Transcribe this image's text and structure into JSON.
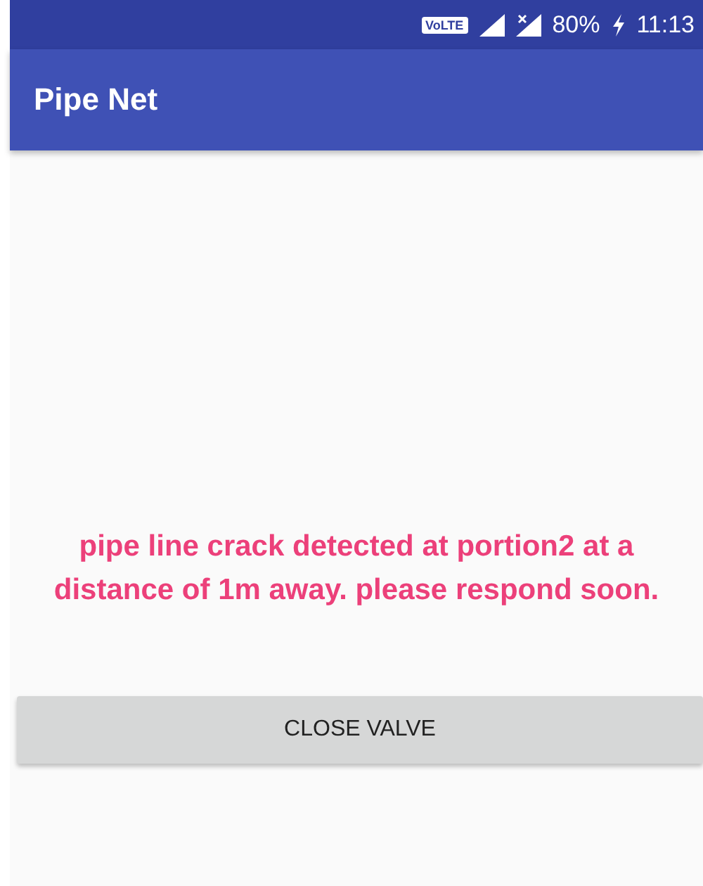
{
  "status_bar": {
    "network_badge": "VoLTE",
    "battery": "80%",
    "time": "11:13"
  },
  "app_bar": {
    "title": "Pipe Net"
  },
  "message": "pipe line crack detected at portion2 at a distance of 1m away. please respond soon.",
  "button": {
    "label": "CLOSE VALVE"
  }
}
